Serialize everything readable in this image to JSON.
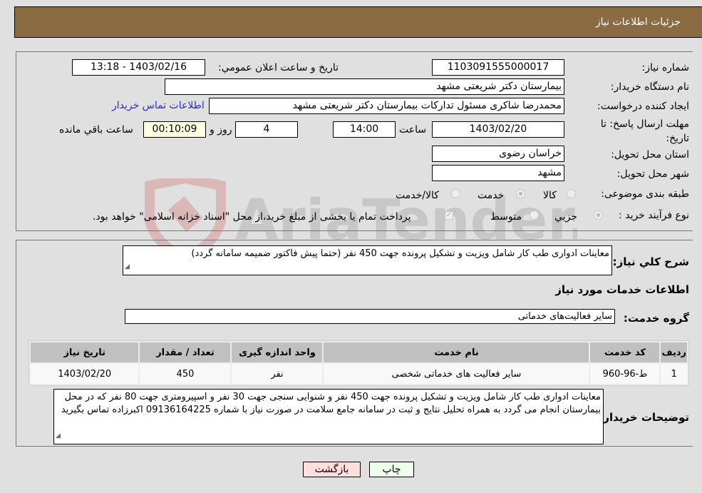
{
  "header": {
    "title": "جزئیات اطلاعات نیاز"
  },
  "fields": {
    "need_number": {
      "label": "شماره نیاز:",
      "value": "1103091555000017"
    },
    "announce_datetime": {
      "label": "تاریخ و ساعت اعلان عمومي:",
      "value": "1403/02/16 - 13:18"
    },
    "buyer_org": {
      "label": "نام دستگاه خریدار:",
      "value": "بیمارستان دکتر شریعتی مشهد"
    },
    "requester": {
      "label": "ایجاد کننده درخواست:",
      "value": "محمدرضا شاکری مسئول تدارکات بیمارستان دکتر شریعتی مشهد"
    },
    "buyer_contact_link": "اطلاعات تماس خریدار",
    "deadline": {
      "label": "مهلت ارسال پاسخ: تا تاریخ:",
      "date": "1403/02/20",
      "time_label": "ساعت",
      "time": "14:00",
      "days": "4",
      "days_label": "روز و",
      "remaining": "00:10:09",
      "remaining_label": "ساعت باقي مانده"
    },
    "province": {
      "label": "استان محل تحویل:",
      "value": "خراسان رضوی"
    },
    "city": {
      "label": "شهر محل تحویل:",
      "value": "مشهد"
    },
    "category": {
      "label": "طبقه بندی موضوعی:",
      "options": [
        "کالا",
        "خدمت",
        "کالا/خدمت"
      ],
      "selected": "خدمت"
    },
    "purchase_type": {
      "label": "نوع فرآیند خرید :",
      "options": [
        "جزیي",
        "متوسط"
      ],
      "selected": "جزیي",
      "treasury_note": "پرداخت تمام یا بخشی از مبلغ خرید،از محل \"اسناد خزانه اسلامی\" خواهد بود."
    }
  },
  "description": {
    "label": "شرح کلي نیاز:",
    "value": "معاینات ادواری طب کار شامل ویزیت و تشکیل پرونده جهت 450 نفر (حتما پیش فاکتور ضمیمه سامانه گردد)"
  },
  "services_section_title": "اطلاعات خدمات مورد نیاز",
  "service_group": {
    "label": "گروه خدمت:",
    "value": "سایر فعالیت‌های خدماتی"
  },
  "table": {
    "headers": [
      "ردیف",
      "کد خدمت",
      "نام خدمت",
      "واحد اندازه گیری",
      "تعداد / مقدار",
      "تاریخ نیاز"
    ],
    "rows": [
      [
        "1",
        "ط-96-960",
        "سایر فعالیت های خدماتی شخصی",
        "نفر",
        "450",
        "1403/02/20"
      ]
    ]
  },
  "buyer_notes": {
    "label": "توضیحات خریدار:",
    "value": "معاینات ادواری طب کار شامل ویزیت و تشکیل پرونده جهت 450 نفر و شنوایی سنجی جهت 30 نفر و اسپیرومتری جهت 80 نفر که در محل بیمارستان انجام می گردد به همراه تحلیل نتایج و ثبت در سامانه جامع سلامت در صورت نیاز با شماره 09136164225 اکبرزاده تماس بگیرید"
  },
  "buttons": {
    "print": "چاپ",
    "back": "بازگشت"
  },
  "watermark": "AriaTender.neT",
  "colors": {
    "header_bg": "#8b6b42",
    "print_bg": "#eeffee",
    "back_bg": "#ffdede",
    "link": "#2a2ad8"
  }
}
